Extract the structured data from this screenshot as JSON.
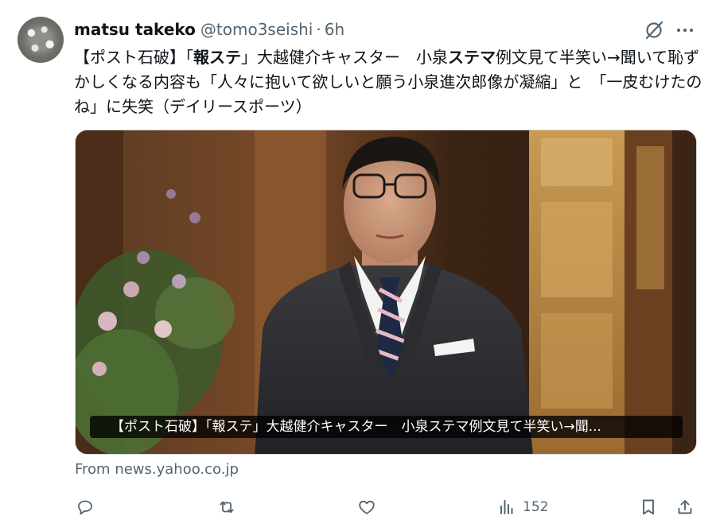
{
  "tweet": {
    "display_name": "matsu takeko",
    "handle": "@tomo3seishi",
    "separator": "·",
    "time": "6h",
    "text_parts": [
      {
        "text": "【ポスト石破】「"
      },
      {
        "text": "報ステ"
      },
      {
        "text": "」大越健介キャスター　小泉"
      },
      {
        "text": "ステマ"
      },
      {
        "text": "例文見て半笑い→聞いて恥ずかしくなる内容も「人々に抱いて欲しいと願う小泉進次郎像が凝縮」と　「一皮むけたのね」に失笑（デイリースポーツ）"
      }
    ]
  },
  "media": {
    "caption": "【ポスト石破】「報ステ」大越健介キャスター　小泉ステマ例文見て半笑い→聞..."
  },
  "source": {
    "label": "From news.yahoo.co.jp"
  },
  "actions": {
    "reply_icon": "reply-icon",
    "retweet_icon": "retweet-icon",
    "like_icon": "heart-icon",
    "views_icon": "views-icon",
    "views_count": "152",
    "bookmark_icon": "bookmark-icon",
    "share_icon": "share-icon"
  },
  "colors": {
    "text": "#0f1419",
    "secondary": "#536471",
    "border": "#cfd9de"
  }
}
